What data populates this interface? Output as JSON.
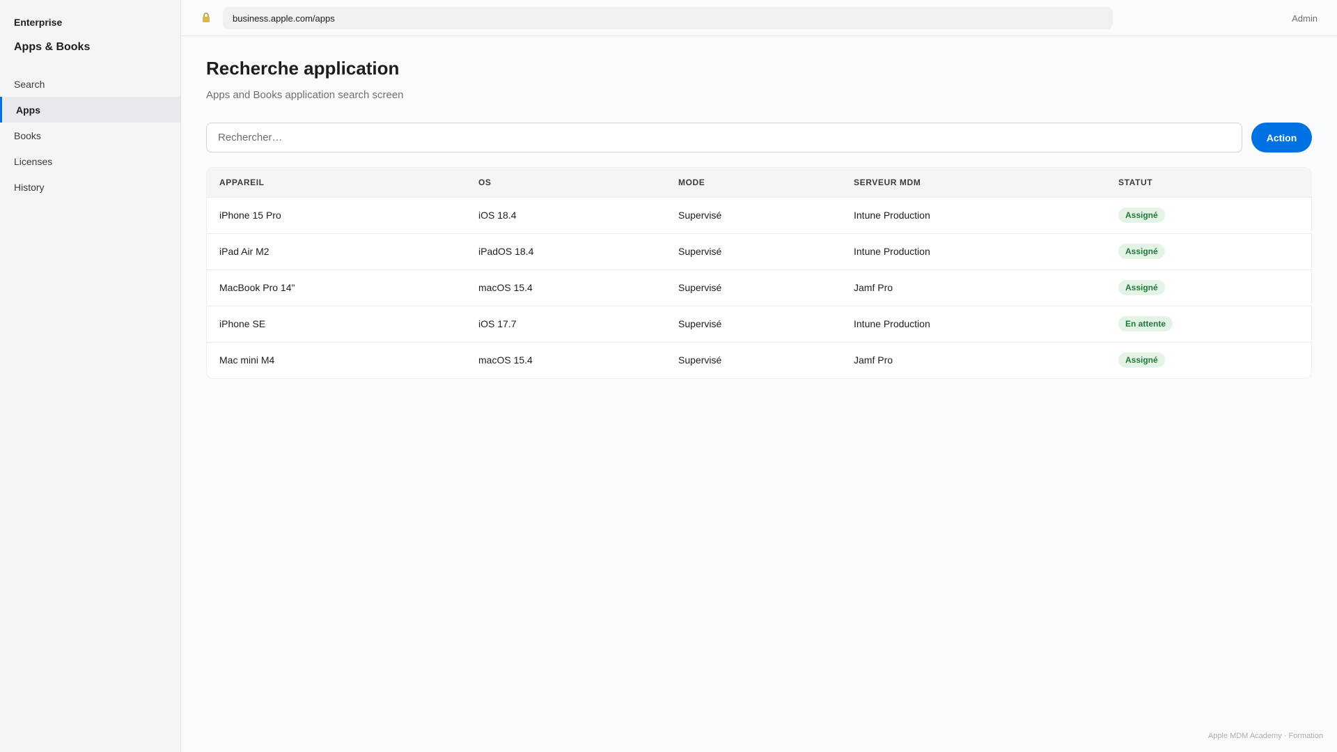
{
  "sidebar": {
    "brand_small": "Enterprise",
    "brand_title": "Apps & Books",
    "items": [
      {
        "label": "Search"
      },
      {
        "label": "Apps"
      },
      {
        "label": "Books"
      },
      {
        "label": "Licenses"
      },
      {
        "label": "History"
      }
    ],
    "active_item": "Apps"
  },
  "topbar": {
    "lock_icon": "lock-icon",
    "url": "business.apple.com/apps",
    "user": "Admin"
  },
  "main": {
    "title": "Recherche application",
    "subtitle": "Apps and Books application search screen",
    "search_placeholder": "Rechercher…",
    "action_label": "Action",
    "table": {
      "headers": [
        "APPAREIL",
        "OS",
        "MODE",
        "SERVEUR MDM",
        "STATUT"
      ],
      "rows": [
        {
          "device": "iPhone 15 Pro",
          "os": "iOS 18.4",
          "mode": "Supervisé",
          "server": "Intune Production",
          "status": "Assigné"
        },
        {
          "device": "iPad Air M2",
          "os": "iPadOS 18.4",
          "mode": "Supervisé",
          "server": "Intune Production",
          "status": "Assigné"
        },
        {
          "device": "MacBook Pro 14\"",
          "os": "macOS 15.4",
          "mode": "Supervisé",
          "server": "Jamf Pro",
          "status": "Assigné"
        },
        {
          "device": "iPhone SE",
          "os": "iOS 17.7",
          "mode": "Supervisé",
          "server": "Intune Production",
          "status": "En attente"
        },
        {
          "device": "Mac mini M4",
          "os": "macOS 15.4",
          "mode": "Supervisé",
          "server": "Jamf Pro",
          "status": "Assigné"
        }
      ]
    }
  },
  "footer": "Apple MDM Academy · Formation",
  "colors": {
    "accent": "#0071e3",
    "status_bg": "#e3f4e6",
    "status_text": "#1f7a38"
  }
}
